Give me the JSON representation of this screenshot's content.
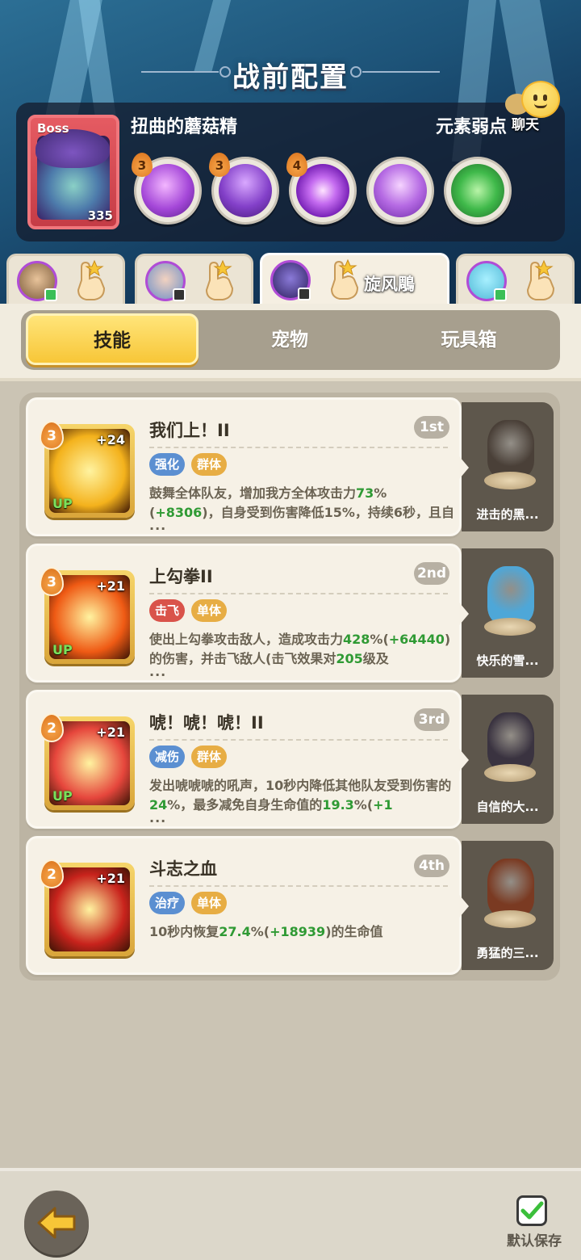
{
  "header": {
    "title": "战前配置"
  },
  "boss": {
    "tag": "Boss",
    "name": "扭曲的蘑菇精",
    "level": "335",
    "weakness_label": "元素弱点",
    "skills": [
      {
        "icon": "swirl-book-icon",
        "level": "3",
        "color": "#b55be0"
      },
      {
        "icon": "spiky-hat-icon",
        "level": "3",
        "color": "#8f4fd1"
      },
      {
        "icon": "sparkle-mushroom-icon",
        "level": "4",
        "color": "#9a44d6"
      },
      {
        "icon": "mushroom-icon",
        "level": "",
        "color": "#b06ae0"
      },
      {
        "icon": "green-slime-icon",
        "level": "",
        "color": "#3fb94a"
      }
    ]
  },
  "chat": {
    "label": "聊天"
  },
  "characters": [
    {
      "name": "",
      "avatar_color": "#7a5a3a",
      "active": false
    },
    {
      "name": "",
      "avatar_color": "#6d8fc7",
      "active": false
    },
    {
      "name": "旋风鵰",
      "avatar_color": "#4b3a8a",
      "active": true
    },
    {
      "name": "",
      "avatar_color": "#4fb8d6",
      "active": false
    }
  ],
  "tabs": {
    "skills": "技能",
    "pets": "宠物",
    "toybox": "玩具箱"
  },
  "skills": [
    {
      "title": "我们上！II",
      "rank": "1st",
      "level": "3",
      "plus": "+24",
      "up": "UP",
      "tags": [
        {
          "label": "强化",
          "color": "blue"
        },
        {
          "label": "群体",
          "color": "orange"
        }
      ],
      "desc_parts": [
        {
          "t": "鼓舞全体队友，增加我方全体攻击力"
        },
        {
          "t": "73",
          "hl": true
        },
        {
          "t": "%("
        },
        {
          "t": "+8306",
          "hl": true
        },
        {
          "t": ")，自身受到伤害降低15%，持续6秒，且自"
        }
      ],
      "ellipsis": "...",
      "icon_theme": "#f4b21c",
      "pet": {
        "name": "进击的黑...",
        "color": "#4a4038"
      }
    },
    {
      "title": "上勾拳II",
      "rank": "2nd",
      "level": "3",
      "plus": "+21",
      "up": "UP",
      "tags": [
        {
          "label": "击飞",
          "color": "red"
        },
        {
          "label": "单体",
          "color": "orange"
        }
      ],
      "desc_parts": [
        {
          "t": "使出上勾拳攻击敌人，造成攻击力"
        },
        {
          "t": "428",
          "hl": true
        },
        {
          "t": "%("
        },
        {
          "t": "+64440",
          "hl": true
        },
        {
          "t": ")的伤害，并击飞敌人(击飞效果对"
        },
        {
          "t": "205",
          "hl": true
        },
        {
          "t": "级及"
        }
      ],
      "ellipsis": "...",
      "icon_theme": "#ef5a14",
      "pet": {
        "name": "快乐的雪...",
        "color": "#4ea7d8"
      }
    },
    {
      "title": "唬！唬！唬！II",
      "rank": "3rd",
      "level": "2",
      "plus": "+21",
      "up": "UP",
      "tags": [
        {
          "label": "减伤",
          "color": "blue"
        },
        {
          "label": "群体",
          "color": "orange"
        }
      ],
      "desc_parts": [
        {
          "t": "发出唬唬唬的吼声，10秒内降低其他队友受到伤害的"
        },
        {
          "t": "24",
          "hl": true
        },
        {
          "t": "%，最多减免自身生命值的"
        },
        {
          "t": "19.3",
          "hl": true
        },
        {
          "t": "%("
        },
        {
          "t": "+1",
          "hl": true
        }
      ],
      "ellipsis": "...",
      "icon_theme": "#e6463c",
      "pet": {
        "name": "自信的大...",
        "color": "#3a3340"
      }
    },
    {
      "title": "斗志之血",
      "rank": "4th",
      "level": "2",
      "plus": "+21",
      "up": "",
      "tags": [
        {
          "label": "治疗",
          "color": "blue"
        },
        {
          "label": "单体",
          "color": "orange"
        }
      ],
      "desc_parts": [
        {
          "t": "10秒内恢复"
        },
        {
          "t": "27.4",
          "hl": true
        },
        {
          "t": "%("
        },
        {
          "t": "+18939",
          "hl": true
        },
        {
          "t": ")的生命值"
        }
      ],
      "ellipsis": "",
      "icon_theme": "#c8231c",
      "pet": {
        "name": "勇猛的三...",
        "color": "#7a3a22"
      }
    }
  ],
  "footer": {
    "save_label": "默认保存"
  }
}
